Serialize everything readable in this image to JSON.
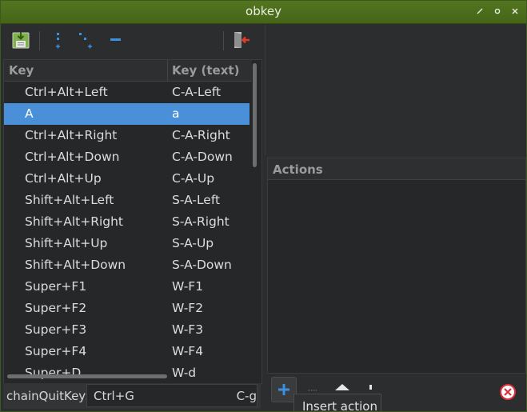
{
  "window": {
    "title": "obkey"
  },
  "toolbar": {
    "buttons": [
      {
        "name": "save-icon"
      },
      {
        "name": "add-sibling-icon"
      },
      {
        "name": "add-child-icon"
      },
      {
        "name": "remove-icon"
      },
      {
        "name": "quit-icon"
      }
    ]
  },
  "key_list": {
    "headers": [
      "Key",
      "Key (text)"
    ],
    "rows": [
      {
        "key": "Ctrl+Alt+Left",
        "text": "C-A-Left",
        "selected": false
      },
      {
        "key": "A",
        "text": "a",
        "selected": true
      },
      {
        "key": "Ctrl+Alt+Right",
        "text": "C-A-Right",
        "selected": false
      },
      {
        "key": "Ctrl+Alt+Down",
        "text": "C-A-Down",
        "selected": false
      },
      {
        "key": "Ctrl+Alt+Up",
        "text": "C-A-Up",
        "selected": false
      },
      {
        "key": "Shift+Alt+Left",
        "text": "S-A-Left",
        "selected": false
      },
      {
        "key": "Shift+Alt+Right",
        "text": "S-A-Right",
        "selected": false
      },
      {
        "key": "Shift+Alt+Up",
        "text": "S-A-Up",
        "selected": false
      },
      {
        "key": "Shift+Alt+Down",
        "text": "S-A-Down",
        "selected": false
      },
      {
        "key": "Super+F1",
        "text": "W-F1",
        "selected": false
      },
      {
        "key": "Super+F2",
        "text": "W-F2",
        "selected": false
      },
      {
        "key": "Super+F3",
        "text": "W-F3",
        "selected": false
      },
      {
        "key": "Super+F4",
        "text": "W-F4",
        "selected": false
      },
      {
        "key": "Super+D",
        "text": "W-d",
        "selected": false
      }
    ]
  },
  "chain": {
    "label": "chainQuitKey:",
    "value": "Ctrl+G",
    "value_text": "C-g"
  },
  "actions": {
    "header": "Actions",
    "tooltip": "Insert action"
  },
  "colors": {
    "titlebar": "#4a6b1c",
    "selection": "#4a90d9",
    "accent_blue": "#3d8fe0",
    "remove_red": "#d9303a"
  }
}
